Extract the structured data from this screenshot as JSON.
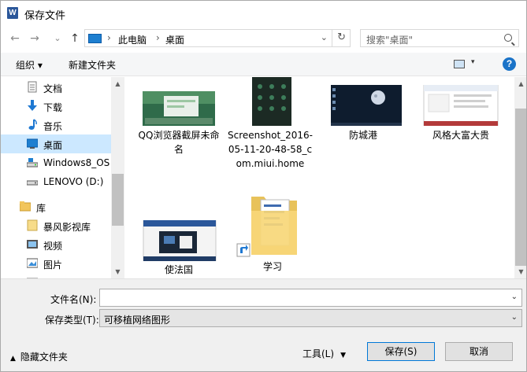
{
  "window": {
    "title": "保存文件",
    "app_icon_letter": "W"
  },
  "nav_buttons": {
    "back": "←",
    "forward": "→",
    "recent": "⌄",
    "up": "↑"
  },
  "address": {
    "crumbs": [
      "此电脑",
      "桌面"
    ],
    "separator": "›",
    "dropdown": "⌄",
    "refresh": "↻"
  },
  "search": {
    "placeholder": "搜索\"桌面\""
  },
  "toolbar": {
    "organize": "组织 ▾",
    "new_folder": "新建文件夹",
    "view_dd": "▾",
    "help": "?"
  },
  "nav_pane": {
    "items": [
      {
        "label": "文档",
        "icon": "document-icon"
      },
      {
        "label": "下载",
        "icon": "download-icon"
      },
      {
        "label": "音乐",
        "icon": "music-icon"
      },
      {
        "label": "桌面",
        "icon": "desktop-icon",
        "selected": true
      },
      {
        "label": "Windows8_OS",
        "icon": "drive-icon"
      },
      {
        "label": "LENOVO (D:)",
        "icon": "drive-icon"
      },
      {
        "label": "库",
        "icon": "library-icon"
      },
      {
        "label": "暴风影视库",
        "icon": "folder-icon"
      },
      {
        "label": "视频",
        "icon": "video-icon"
      },
      {
        "label": "图片",
        "icon": "pictures-icon"
      }
    ]
  },
  "files": [
    {
      "name": "QQ浏览器截屏未命名",
      "kind": "screenshot-green"
    },
    {
      "name": "Screenshot_2016-05-11-20-48-58_com.miui.home",
      "kind": "phone-screenshot"
    },
    {
      "name": "防城港",
      "kind": "moon-wallpaper"
    },
    {
      "name": "风格大富大贵",
      "kind": "document-preview"
    },
    {
      "name": "使法国",
      "kind": "word-doc-preview"
    },
    {
      "name": "学习",
      "kind": "folder-shortcut"
    }
  ],
  "bottom": {
    "filename_label": "文件名(N):",
    "filename_value": "",
    "filetype_label": "保存类型(T):",
    "filetype_value": "可移植网络图形",
    "hide_folders": "隐藏文件夹",
    "tools": "工具(L)",
    "save": "保存(S)",
    "cancel": "取消"
  },
  "colors": {
    "selection": "#cce8ff",
    "accent": "#0078d7",
    "toolbar_bg": "#f5f6f7",
    "bottom_bg": "#f0f0f0"
  }
}
